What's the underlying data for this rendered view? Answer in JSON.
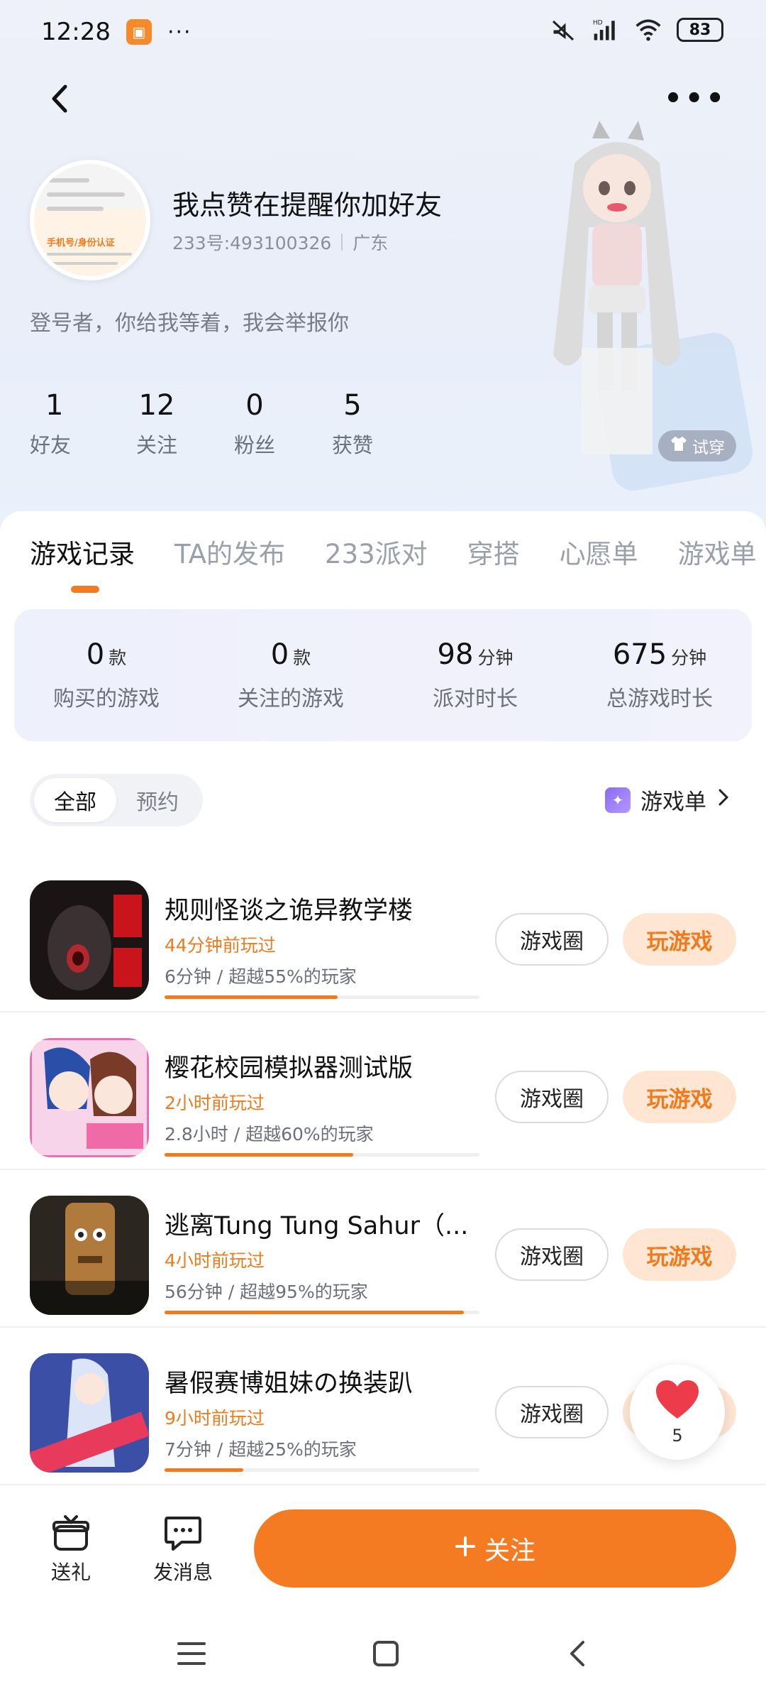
{
  "status_bar": {
    "time": "12:28",
    "dots": "···",
    "battery": "83",
    "icons": [
      "mute-icon",
      "hd-signal-icon",
      "wifi-icon",
      "battery-icon"
    ]
  },
  "header": {
    "back_icon": "back-arrow-icon",
    "more_icon": "more-icon"
  },
  "profile": {
    "name": "我点赞在提醒你加好友",
    "id_text": "233号:493100326",
    "region": "广东",
    "bio": "登号者，你给我等着，我会举报你",
    "avatar_tag": "手机号/身份认证",
    "stats": [
      {
        "value": "1",
        "label": "好友"
      },
      {
        "value": "12",
        "label": "关注"
      },
      {
        "value": "0",
        "label": "粉丝"
      },
      {
        "value": "5",
        "label": "获赞"
      }
    ],
    "tryon_label": "试穿"
  },
  "tabs": [
    "游戏记录",
    "TA的发布",
    "233派对",
    "穿搭",
    "心愿单",
    "游戏单"
  ],
  "summary": [
    {
      "value": "0",
      "unit": "款",
      "label": "购买的游戏"
    },
    {
      "value": "0",
      "unit": "款",
      "label": "关注的游戏"
    },
    {
      "value": "98",
      "unit": "分钟",
      "label": "派对时长"
    },
    {
      "value": "675",
      "unit": "分钟",
      "label": "总游戏时长"
    }
  ],
  "filter": {
    "options": [
      "全部",
      "预约"
    ],
    "selected": "全部"
  },
  "gamelist_link": "游戏单",
  "game_buttons": {
    "circle": "游戏圈",
    "play": "玩游戏"
  },
  "games": [
    {
      "title": "规则怪谈之诡异教学楼",
      "last_played": "44分钟前玩过",
      "stat": "6分钟 / 超越55%的玩家",
      "progress": 0.55
    },
    {
      "title": "樱花校园模拟器测试版",
      "last_played": "2小时前玩过",
      "stat": "2.8小时 / 超越60%的玩家",
      "progress": 0.6
    },
    {
      "title": "逃离Tung Tung Sahur（...",
      "last_played": "4小时前玩过",
      "stat": "56分钟 / 超越95%的玩家",
      "progress": 0.95
    },
    {
      "title": "暑假赛博姐妹の换装趴",
      "last_played": "9小时前玩过",
      "stat": "7分钟 / 超越25%的玩家",
      "progress": 0.25
    }
  ],
  "like_float": {
    "count": "5"
  },
  "bottom_bar": {
    "gift_label": "送礼",
    "message_label": "发消息",
    "follow_label": "关注"
  },
  "colors": {
    "accent": "#f47b22",
    "accent_light": "#fee6d3",
    "text_secondary": "#6b707a"
  }
}
